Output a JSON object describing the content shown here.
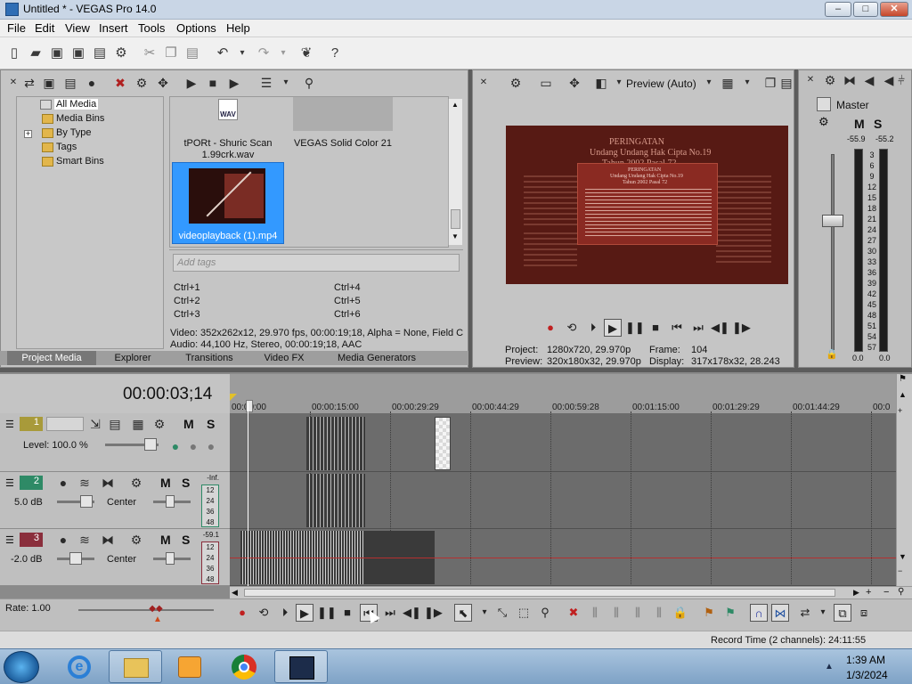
{
  "window": {
    "title": "Untitled * - VEGAS Pro 14.0",
    "minimize": "–",
    "maximize": "□",
    "close": "✕"
  },
  "menu": [
    "File",
    "Edit",
    "View",
    "Insert",
    "Tools",
    "Options",
    "Help"
  ],
  "media_tree": {
    "items": [
      "All Media",
      "Media Bins",
      "By Type",
      "Tags",
      "Smart Bins"
    ],
    "expand_glyph": "+"
  },
  "media_files": [
    {
      "name": "tPORt - Shuric Scan 1.99crk.wav",
      "badge": "WAV"
    },
    {
      "name": "VEGAS Solid Color 21"
    },
    {
      "name": "videoplayback (1).mp4"
    }
  ],
  "tags": {
    "placeholder": "Add tags",
    "shortcuts": [
      "Ctrl+1",
      "Ctrl+2",
      "Ctrl+3",
      "Ctrl+4",
      "Ctrl+5",
      "Ctrl+6"
    ]
  },
  "media_info": {
    "video": "Video: 352x262x12, 29.970 fps, 00:00:19;18, Alpha = None, Field C",
    "audio": "Audio: 44,100 Hz, Stereo, 00:00:19;18, AAC"
  },
  "left_tabs": [
    "Project Media",
    "Explorer",
    "Transitions",
    "Video FX",
    "Media Generators"
  ],
  "preview": {
    "mode": "Preview (Auto)",
    "project_label": "Project:",
    "project_value": "1280x720, 29.970p",
    "frame_label": "Frame:",
    "frame_value": "104",
    "preview_label": "Preview:",
    "preview_value": "320x180x32, 29.970p",
    "display_label": "Display:",
    "display_value": "317x178x32, 28.243",
    "doc_heading": "PERINGATAN",
    "doc_sub1": "Undang Undang Hak Cipta No.19",
    "doc_sub2": "Tahun 2002 Pasal 72",
    "doc_inner_heading": "PERINGATAN",
    "doc_inner_sub1": "Undang Undang Hak Cipta No.19",
    "doc_inner_sub2": "Tahun 2002 Pasal 72"
  },
  "master": {
    "label": "Master",
    "mute": "M",
    "solo": "S",
    "peak_left": "-55.9",
    "peak_right": "-55.2",
    "scale": [
      "3",
      "6",
      "9",
      "12",
      "15",
      "18",
      "21",
      "24",
      "27",
      "30",
      "33",
      "36",
      "39",
      "42",
      "45",
      "48",
      "51",
      "54",
      "57"
    ],
    "fader_left": "0.0",
    "fader_right": "0.0"
  },
  "timeline": {
    "timecode": "00:00:03;14",
    "ruler": [
      "00:00:00",
      "00:00:15:00",
      "00:00:29:29",
      "00:00:44:29",
      "00:00:59:28",
      "00:01:15:00",
      "00:01:29:29",
      "00:01:44:29",
      "00:0"
    ],
    "tracks": [
      {
        "number": "1",
        "level_label": "Level: 100.0 %"
      },
      {
        "number": "2",
        "volume": "5.0 dB",
        "pan": "Center",
        "meter_top": "-Inf.",
        "meter_scale": [
          "12",
          "24",
          "36",
          "48"
        ]
      },
      {
        "number": "3",
        "volume": "-2.0 dB",
        "pan": "Center",
        "meter_top": "-59.1",
        "meter_scale": [
          "12",
          "24",
          "36",
          "48"
        ]
      }
    ],
    "rate": "Rate: 1.00",
    "record_time": "Record Time (2 channels): 24:11:55",
    "mute": "M",
    "solo": "S"
  },
  "taskbar": {
    "time": "1:39 AM",
    "date": "1/3/2024"
  },
  "colors": {
    "accent_blue": "#3399ff",
    "preview_bg": "#571a14",
    "track1": "#a89a3a",
    "track2": "#2e8a66",
    "track3": "#8a2e3c"
  }
}
